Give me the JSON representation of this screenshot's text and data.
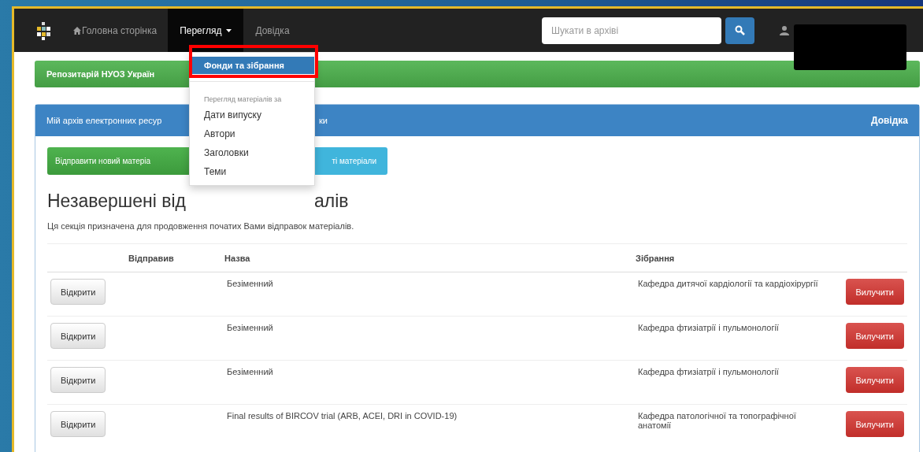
{
  "navbar": {
    "home": "Головна сторінка",
    "menus": [
      {
        "label": "Перегляд",
        "selected": true,
        "caret": true
      },
      {
        "label": "Довідка",
        "selected": false,
        "caret": false
      }
    ],
    "search": {
      "placeholder": "Шукати в архіві"
    }
  },
  "dropdown": {
    "items": [
      {
        "kind": "item",
        "label": "Фонди та зібрання",
        "selected": true
      },
      {
        "kind": "divider"
      },
      {
        "kind": "header",
        "label": "Перегляд матеріалів за"
      },
      {
        "kind": "item",
        "label": "Дати випуску",
        "selected": false
      },
      {
        "kind": "item",
        "label": "Автори",
        "selected": false
      },
      {
        "kind": "item",
        "label": "Заголовки",
        "selected": false
      },
      {
        "kind": "item",
        "label": "Теми",
        "selected": false
      }
    ]
  },
  "banner": "Репозитарій НУОЗ Україн",
  "panel": {
    "title": "Мій архів електронних ресур",
    "title_tail": "ки",
    "help": "Довідка",
    "buttons": [
      {
        "kind": "success",
        "label": "Відправити новий матеріа"
      },
      {
        "kind": "info",
        "label": "ті матеріали"
      }
    ],
    "heading": "Незавершені від",
    "heading_tail": "алів",
    "description": "Ця секція призначена для продовження початих Вами відправок матеріалів.",
    "table": {
      "columns": [
        "Відправив",
        "Назва",
        "Зібрання"
      ],
      "rows": [
        {
          "open": "Відкрити",
          "title": "Безіменний",
          "collection": "Кафедра дитячої кардіології та кардіохірургії",
          "remove": "Вилучити"
        },
        {
          "open": "Відкрити",
          "title": "Безіменний",
          "collection": "Кафедра фтизіатрії і пульмонології",
          "remove": "Вилучити"
        },
        {
          "open": "Відкрити",
          "title": "Безіменний",
          "collection": "Кафедра фтизіатрії і пульмонології",
          "remove": "Вилучити"
        },
        {
          "open": "Відкрити",
          "title": "Final results of BIRCOV trial (ARB, ACEI, DRI in COVID-19)",
          "collection": "Кафедра патологічної та топографічної анатомії",
          "remove": "Вилучити"
        }
      ]
    }
  }
}
